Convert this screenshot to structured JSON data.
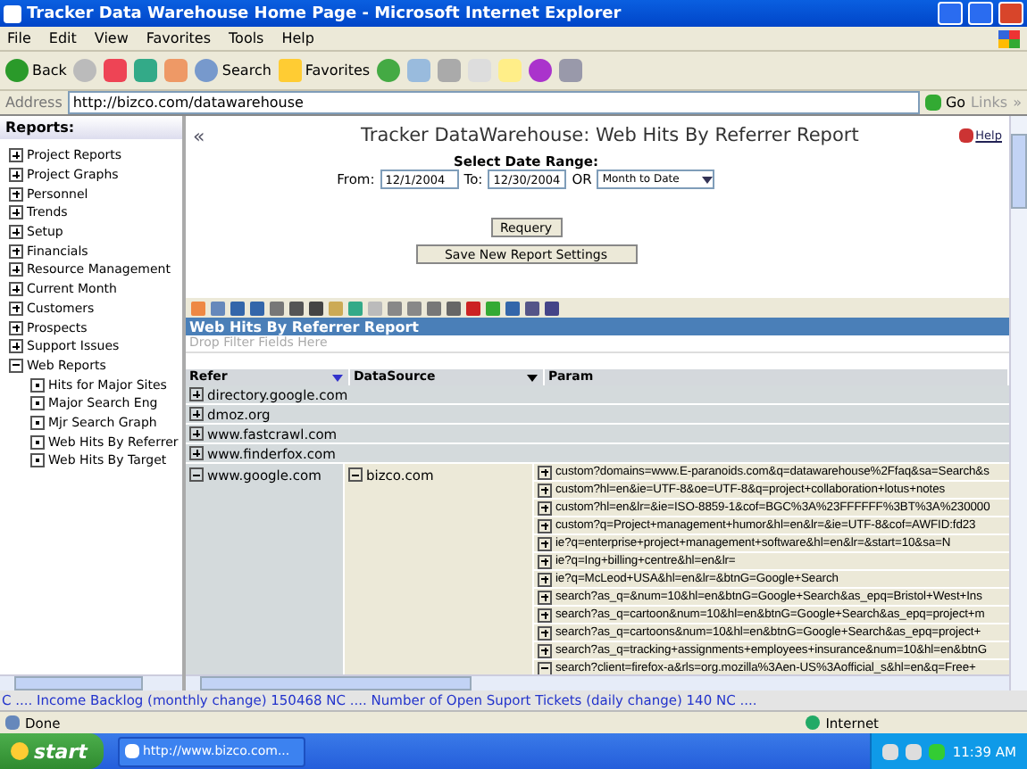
{
  "window": {
    "title": "Tracker Data Warehouse Home Page - Microsoft Internet Explorer"
  },
  "menu": [
    "File",
    "Edit",
    "View",
    "Favorites",
    "Tools",
    "Help"
  ],
  "toolbar": {
    "back": "Back",
    "search": "Search",
    "favorites": "Favorites"
  },
  "address": {
    "label": "Address",
    "value": "http://bizco.com/datawarehouse",
    "go": "Go",
    "links": "Links",
    "more": "»"
  },
  "sidebar": {
    "title": "Reports:",
    "items": [
      {
        "label": "Project Reports",
        "expanded": false
      },
      {
        "label": "Project Graphs",
        "expanded": false
      },
      {
        "label": "Personnel",
        "expanded": false
      },
      {
        "label": "Trends",
        "expanded": false
      },
      {
        "label": "Setup",
        "expanded": false
      },
      {
        "label": "Financials",
        "expanded": false
      },
      {
        "label": "Resource Management",
        "expanded": false
      },
      {
        "label": "Current Month",
        "expanded": false
      },
      {
        "label": "Customers",
        "expanded": false
      },
      {
        "label": "Prospects",
        "expanded": false
      },
      {
        "label": "Support Issues",
        "expanded": false
      },
      {
        "label": "Web Reports",
        "expanded": true,
        "children": [
          {
            "label": "Hits for Major Sites"
          },
          {
            "label": "Major Search Eng"
          },
          {
            "label": "Mjr Search Graph"
          },
          {
            "label": "Web Hits By Referrer"
          },
          {
            "label": "Web Hits By Target"
          }
        ]
      }
    ]
  },
  "report": {
    "collapse": "«",
    "title": "Tracker DataWarehouse: Web Hits By Referrer Report",
    "help": "Help",
    "date_heading": "Select Date Range:",
    "from_label": "From:",
    "from": "12/1/2004",
    "to_label": "To:",
    "to": "12/30/2004",
    "or": "OR",
    "period": "Month to Date",
    "buttons": [
      "Requery",
      "Save New Report Settings"
    ]
  },
  "grid": {
    "title": "Web Hits By Referrer Report",
    "filter_placeholder": "Drop Filter Fields Here",
    "columns": [
      "Refer",
      "DataSource",
      "Param"
    ],
    "rows": [
      {
        "refer": "directory.google.com",
        "expanded": false
      },
      {
        "refer": "dmoz.org",
        "expanded": false
      },
      {
        "refer": "www.fastcrawl.com",
        "expanded": false
      },
      {
        "refer": "www.finderfox.com",
        "expanded": false
      },
      {
        "refer": "www.google.com",
        "expanded": true,
        "datasource": "bizco.com",
        "datasource_expanded": true,
        "params": [
          {
            "text": "custom?domains=www.E-paranoids.com&q=datawarehouse%2Ffaq&sa=Search&s",
            "expanded": false
          },
          {
            "text": "custom?hl=en&ie=UTF-8&oe=UTF-8&q=project+collaboration+lotus+notes",
            "expanded": false
          },
          {
            "text": "custom?hl=en&lr=&ie=ISO-8859-1&cof=BGC%3A%23FFFFFF%3BT%3A%230000",
            "expanded": false
          },
          {
            "text": "custom?q=Project+management+humor&hl=en&lr=&ie=UTF-8&cof=AWFID:fd23",
            "expanded": false
          },
          {
            "text": "ie?q=enterprise+project+management+software&hl=en&lr=&start=10&sa=N",
            "expanded": false
          },
          {
            "text": "ie?q=Ing+billing+centre&hl=en&lr=",
            "expanded": false
          },
          {
            "text": "ie?q=McLeod+USA&hl=en&lr=&btnG=Google+Search",
            "expanded": false
          },
          {
            "text": "search?as_q=&num=10&hl=en&btnG=Google+Search&as_epq=Bristol+West+Ins",
            "expanded": false
          },
          {
            "text": "search?as_q=cartoon&num=10&hl=en&btnG=Google+Search&as_epq=project+m",
            "expanded": false
          },
          {
            "text": "search?as_q=cartoons&num=10&hl=en&btnG=Google+Search&as_epq=project+",
            "expanded": false
          },
          {
            "text": "search?as_q=tracking+assignments+employees+insurance&num=10&hl=en&btnG",
            "expanded": false
          },
          {
            "text": "search?client=firefox-a&rls=org.mozilla%3Aen-US%3Aofficial_s&hl=en&q=Free+",
            "expanded": true
          }
        ]
      }
    ]
  },
  "ticker": "C .... Income Backlog (monthly change) 150468 NC .... Number of Open Suport Tickets (daily change) 140 NC ....",
  "status": {
    "text": "Done",
    "zone": "Internet"
  },
  "taskbar": {
    "start": "start",
    "task": "http://www.bizco.com...",
    "time": "11:39 AM"
  }
}
